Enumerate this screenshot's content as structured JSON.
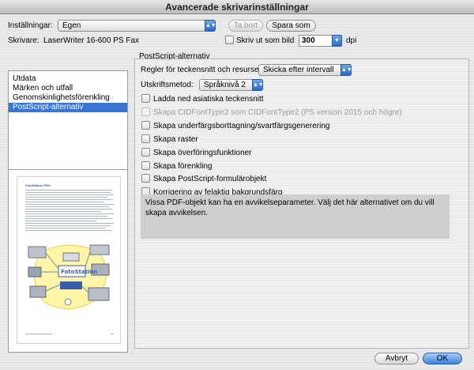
{
  "window": {
    "title": "Avancerade skrivarinställningar"
  },
  "settings": {
    "label": "Inställningar:",
    "value": "Egen"
  },
  "buttons": {
    "delete": "Ta bort",
    "save_as": "Spara som",
    "cancel": "Avbryt",
    "ok": "OK"
  },
  "printer": {
    "label": "Skrivare:",
    "name": "LaserWriter 16-600 PS Fax",
    "print_as_image": "Skriv ut som bild",
    "dpi_value": "300",
    "dpi_unit": "dpi"
  },
  "sidebar": {
    "items": [
      {
        "label": "Utdata"
      },
      {
        "label": "Märken och utfall"
      },
      {
        "label": "Genomskinlighetsförenkling"
      },
      {
        "label": "PostScript-alternativ"
      }
    ]
  },
  "preview": {
    "page_title": "FotoStation PRO"
  },
  "postscript": {
    "section_title": "PostScript-alternativ",
    "font_rules_label": "Regler för teckensnitt och resurser:",
    "font_rules_value": "Skicka efter intervall",
    "print_method_label": "Utskriftsmetod:",
    "print_method_value": "Språknivå 2",
    "checkboxes": [
      {
        "label": "Ladda ned asiatiska teckensnitt",
        "disabled": false
      },
      {
        "label": "Skapa CIDFontType2 som CIDFontType2 (PS version 2015 och högre)",
        "disabled": true
      },
      {
        "label": "Skapa underfärgsborttagning/svartfärgsgenerering",
        "disabled": false
      },
      {
        "label": "Skapa raster",
        "disabled": false
      },
      {
        "label": "Skapa överföringsfunktioner",
        "disabled": false
      },
      {
        "label": "Skapa förenkling",
        "disabled": false
      },
      {
        "label": "Skapa PostScript-formulärobjekt",
        "disabled": false
      },
      {
        "label": "Korrigering av felaktig bakgrundsfärg",
        "disabled": false
      }
    ],
    "description": "Vissa PDF-objekt kan ha en avvikelseparameter. Välj det här alternativet om du vill skapa avvikelsen."
  }
}
